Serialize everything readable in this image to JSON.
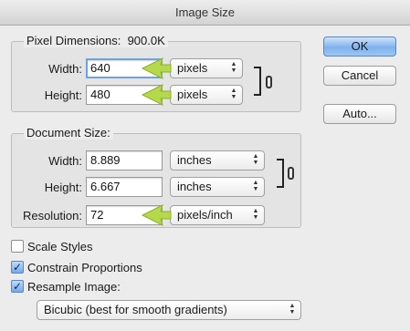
{
  "window": {
    "title": "Image Size"
  },
  "pixel_dimensions": {
    "title": "Pixel Dimensions:",
    "size": "900.0K",
    "width": {
      "label": "Width:",
      "value": "640",
      "unit": "pixels"
    },
    "height": {
      "label": "Height:",
      "value": "480",
      "unit": "pixels"
    }
  },
  "document_size": {
    "title": "Document Size:",
    "width": {
      "label": "Width:",
      "value": "8.889",
      "unit": "inches"
    },
    "height": {
      "label": "Height:",
      "value": "6.667",
      "unit": "inches"
    },
    "resolution": {
      "label": "Resolution:",
      "value": "72",
      "unit": "pixels/inch"
    }
  },
  "options": {
    "scale_styles": {
      "label": "Scale Styles",
      "checked": false
    },
    "constrain_proportions": {
      "label": "Constrain Proportions",
      "checked": true
    },
    "resample_image": {
      "label": "Resample Image:",
      "checked": true
    },
    "resample_method": "Bicubic (best for smooth gradients)"
  },
  "buttons": {
    "ok": "OK",
    "cancel": "Cancel",
    "auto": "Auto..."
  },
  "colors": {
    "accent_blue": "#7fb2ee",
    "annotation_arrow": "#b5d94a",
    "focus_ring": "#6aa3e6"
  }
}
